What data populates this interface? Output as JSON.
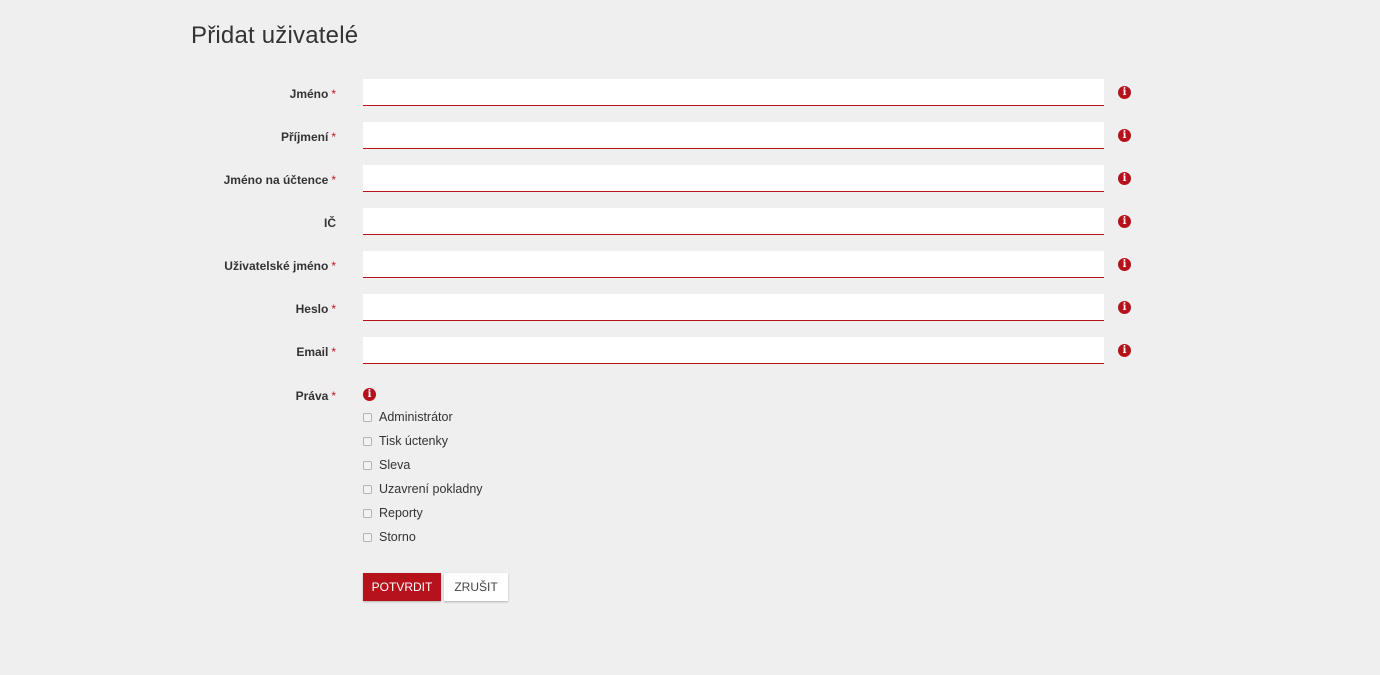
{
  "title": "Přidat uživatelé",
  "required_mark": "*",
  "info_glyph": "i",
  "fields": [
    {
      "label": "Jméno",
      "required": true,
      "value": "",
      "placeholder": ""
    },
    {
      "label": "Příjmení",
      "required": true,
      "value": "",
      "placeholder": ""
    },
    {
      "label": "Jméno na účtence",
      "required": true,
      "value": "",
      "placeholder": ""
    },
    {
      "label": "IČ",
      "required": false,
      "value": "",
      "placeholder": ""
    },
    {
      "label": "Uživatelské jméno",
      "required": true,
      "value": "",
      "placeholder": ""
    },
    {
      "label": "Heslo",
      "required": true,
      "value": "",
      "placeholder": ""
    },
    {
      "label": "Email",
      "required": true,
      "value": "",
      "placeholder": ""
    }
  ],
  "rights": {
    "label": "Práva",
    "required": true,
    "options": [
      {
        "label": "Administrátor",
        "checked": false
      },
      {
        "label": "Tisk úctenky",
        "checked": false
      },
      {
        "label": "Sleva",
        "checked": false
      },
      {
        "label": "Uzavrení pokladny",
        "checked": false
      },
      {
        "label": "Reporty",
        "checked": false
      },
      {
        "label": "Storno",
        "checked": false
      }
    ]
  },
  "buttons": {
    "submit": "POTVRDIT",
    "cancel": "ZRUŠIT"
  },
  "colors": {
    "accent": "#b5121b",
    "background": "#f0efef"
  }
}
